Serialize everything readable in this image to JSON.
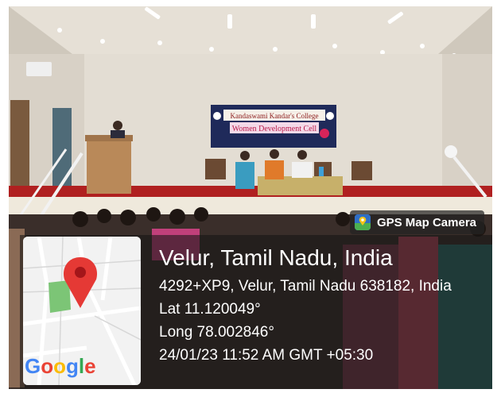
{
  "banner": {
    "college": "Kandaswami Kandar's College",
    "cell": "Women Development Cell"
  },
  "gps_tag": {
    "app_name": "GPS Map Camera",
    "logo_icon": "gps-map-camera-icon"
  },
  "map": {
    "brand": "Google",
    "pin_icon": "location-pin-icon",
    "colors": {
      "pin": "#e53935",
      "park": "#7cc576"
    }
  },
  "location": {
    "place": "Velur, Tamil Nadu, India",
    "address": "4292+XP9, Velur, Tamil Nadu 638182, India",
    "lat": "Lat 11.120049°",
    "long": "Long 78.002846°",
    "datetime": "24/01/23 11:52 AM GMT +05:30"
  }
}
